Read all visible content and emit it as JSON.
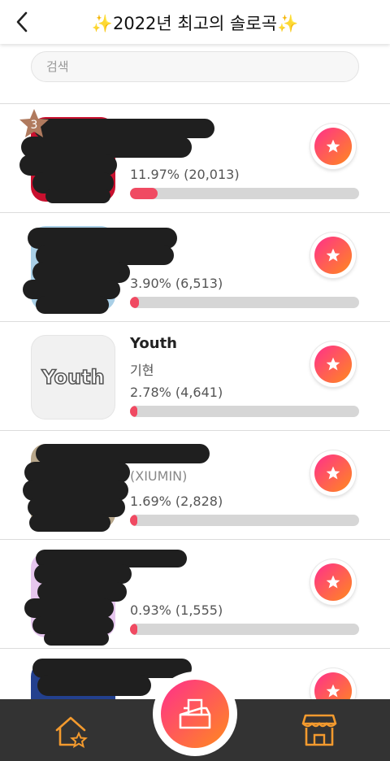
{
  "header": {
    "title": "✨2022년 최고의 솔로곡✨",
    "back_icon": "chevron-left-icon"
  },
  "search": {
    "placeholder": "검색",
    "value": ""
  },
  "rows": [
    {
      "song": "",
      "artist": "",
      "percent_text": "11.97% (20,013)",
      "percent": 11.97,
      "rank": "3"
    },
    {
      "song": "",
      "artist": "",
      "percent_text": "3.90% (6,513)",
      "percent": 3.9
    },
    {
      "song": "Youth",
      "artist": "기현",
      "percent_text": "2.78% (4,641)",
      "percent": 2.78,
      "album_art_text": "Youth"
    },
    {
      "song": "",
      "artist": "(XIUMIN)",
      "percent_text": "1.69% (2,828)",
      "percent": 1.69
    },
    {
      "song": "",
      "artist": "",
      "percent_text": "0.93% (1,555)",
      "percent": 0.93
    },
    {
      "song": "",
      "artist": "",
      "percent_text": "",
      "percent": 0
    }
  ],
  "bottom_nav": {
    "home_icon": "home-star-icon",
    "vote_box_icon": "ballot-box-icon",
    "shop_icon": "store-icon"
  },
  "colors": {
    "accent_pink": "#ff2f8c",
    "accent_orange": "#ff8a1e",
    "bar_fill": "#f04a62",
    "bottom_bar": "#333333"
  }
}
